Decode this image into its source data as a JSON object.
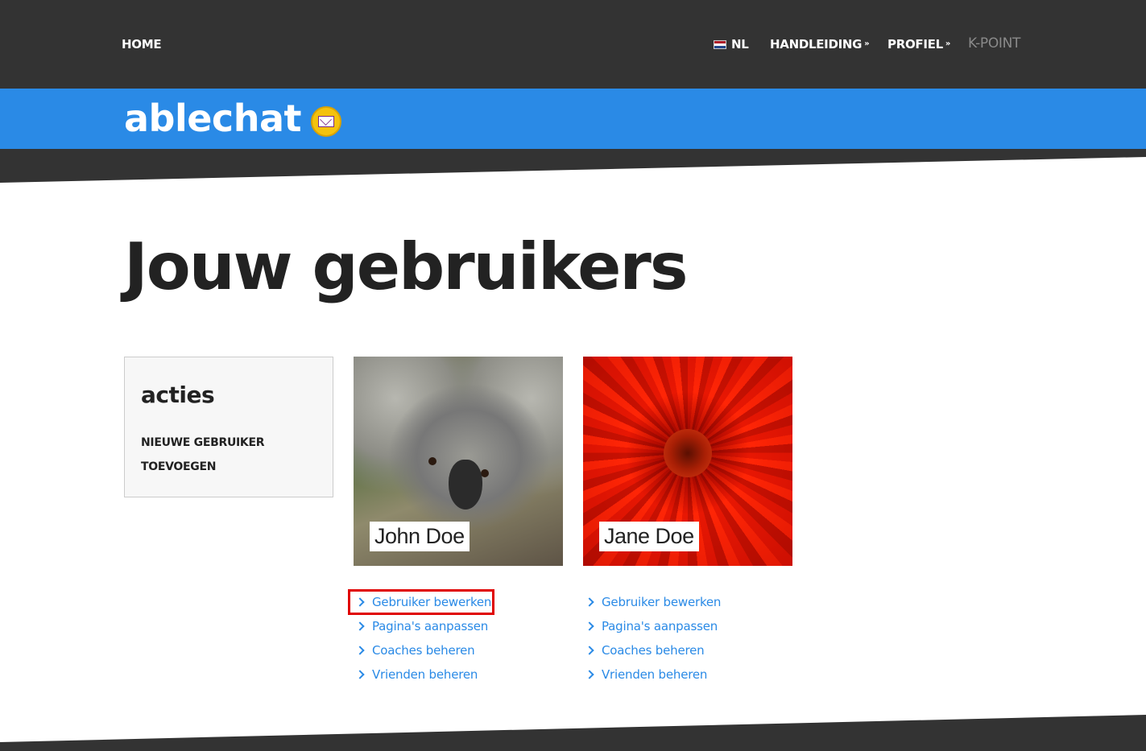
{
  "nav": {
    "home": "HOME",
    "language": "NL",
    "manual": "HANDLEIDING",
    "profile": "PROFIEL",
    "kpoint": "K-POINT"
  },
  "brand": {
    "name": "ablechat"
  },
  "page": {
    "title": "Jouw gebruikers"
  },
  "actions": {
    "title": "acties",
    "new_user": "NIEUWE GEBRUIKER TOEVOEGEN"
  },
  "users": [
    {
      "name": "John Doe",
      "links": [
        "Gebruiker bewerken",
        "Pagina's aanpassen",
        "Coaches beheren",
        "Vrienden beheren"
      ]
    },
    {
      "name": "Jane Doe",
      "links": [
        "Gebruiker bewerken",
        "Pagina's aanpassen",
        "Coaches beheren",
        "Vrienden beheren"
      ]
    }
  ],
  "colors": {
    "topbar": "#333333",
    "brand_blue": "#2a8ae6",
    "link_blue": "#2a8ae6",
    "highlight_red": "#e00000",
    "mail_icon_yellow": "#f4c20d"
  },
  "icons": {
    "language_flag": "netherlands-flag-icon",
    "dropdown": "double-chevron-down-icon",
    "brand_badge": "mail-envelope-icon",
    "link_bullet": "chevron-right-icon"
  }
}
